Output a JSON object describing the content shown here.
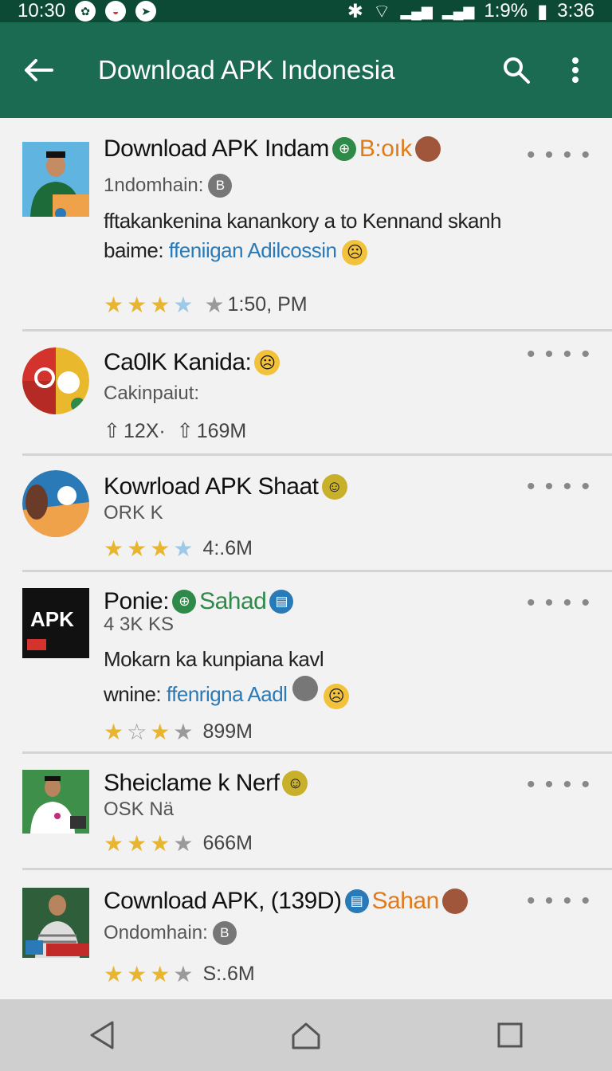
{
  "status_bar": {
    "time": "10:30",
    "battery": "1:9%",
    "clock_right": "3:36"
  },
  "app_bar": {
    "title": "Download APK Indonesia"
  },
  "items": [
    {
      "title": "Download APK Indam",
      "tag": "B:oık",
      "subtitle": "1ndomhain:",
      "desc_line1": "fftakankenina kanankory a to Kennand skanh",
      "desc_line2_prefix": "baime: ",
      "desc_line2_link": "ffeniigan Adilcossin",
      "meta": "1:50, PM"
    },
    {
      "title": "Ca0lK Kanida:",
      "subtitle": "Cakinpaiut:",
      "stat1": "12X·",
      "stat2": "169M"
    },
    {
      "title": "Kowrload APK Shaat",
      "subtitle": "ORK K",
      "meta": "4:.6M"
    },
    {
      "title": "Ponie:",
      "tag": "Sahad",
      "subtitle": "4 3K KS",
      "thumb_label": "APK",
      "desc_line1": "Mokarn  ka kunpiana kavl",
      "desc_line2_prefix": "wnine: ",
      "desc_line2_link": "ffenrigna Aadl",
      "meta": "899M"
    },
    {
      "title": "Sheiclame k Nerf",
      "subtitle": "OSK Nä",
      "meta": "666M"
    },
    {
      "title": "Cownload APK, (139D)",
      "tag": "Sahan",
      "subtitle": "Ondomhain:",
      "meta": "S:.6M"
    }
  ],
  "colors": {
    "status_bar": "#0d4a35",
    "app_bar": "#1b6a52",
    "star": "#e8b530",
    "link": "#2a7ab8",
    "tag_orange": "#e07b1c",
    "tag_green": "#2f8a4a"
  }
}
